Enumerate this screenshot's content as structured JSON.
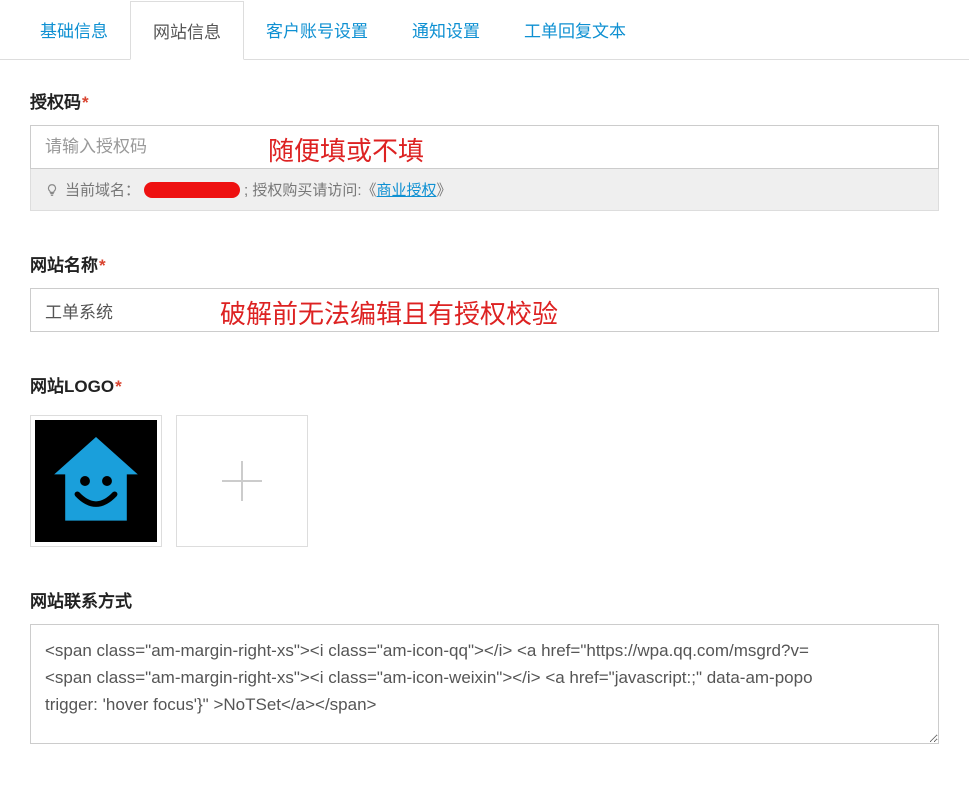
{
  "tabs": {
    "t0": "基础信息",
    "t1": "网站信息",
    "t2": "客户账号设置",
    "t3": "通知设置",
    "t4": "工单回复文本"
  },
  "auth": {
    "label": "授权码",
    "placeholder": "请输入授权码",
    "overlay": "随便填或不填",
    "hint_domain_prefix": "当前域名：",
    "hint_buy": " ; 授权购买请访问:《",
    "hint_link": "商业授权",
    "hint_close": "》"
  },
  "site_name": {
    "label": "网站名称",
    "value": "工单系统",
    "overlay": "破解前无法编辑且有授权校验"
  },
  "logo": {
    "label": "网站LOGO"
  },
  "contact": {
    "label": "网站联系方式",
    "value": "<span class=\"am-margin-right-xs\"><i class=\"am-icon-qq\"></i> <a href=\"https://wpa.qq.com/msgrd?v=\n<span class=\"am-margin-right-xs\"><i class=\"am-icon-weixin\"></i> <a href=\"javascript:;\" data-am-popo\ntrigger: 'hover focus'}\" >NoTSet</a></span>"
  }
}
